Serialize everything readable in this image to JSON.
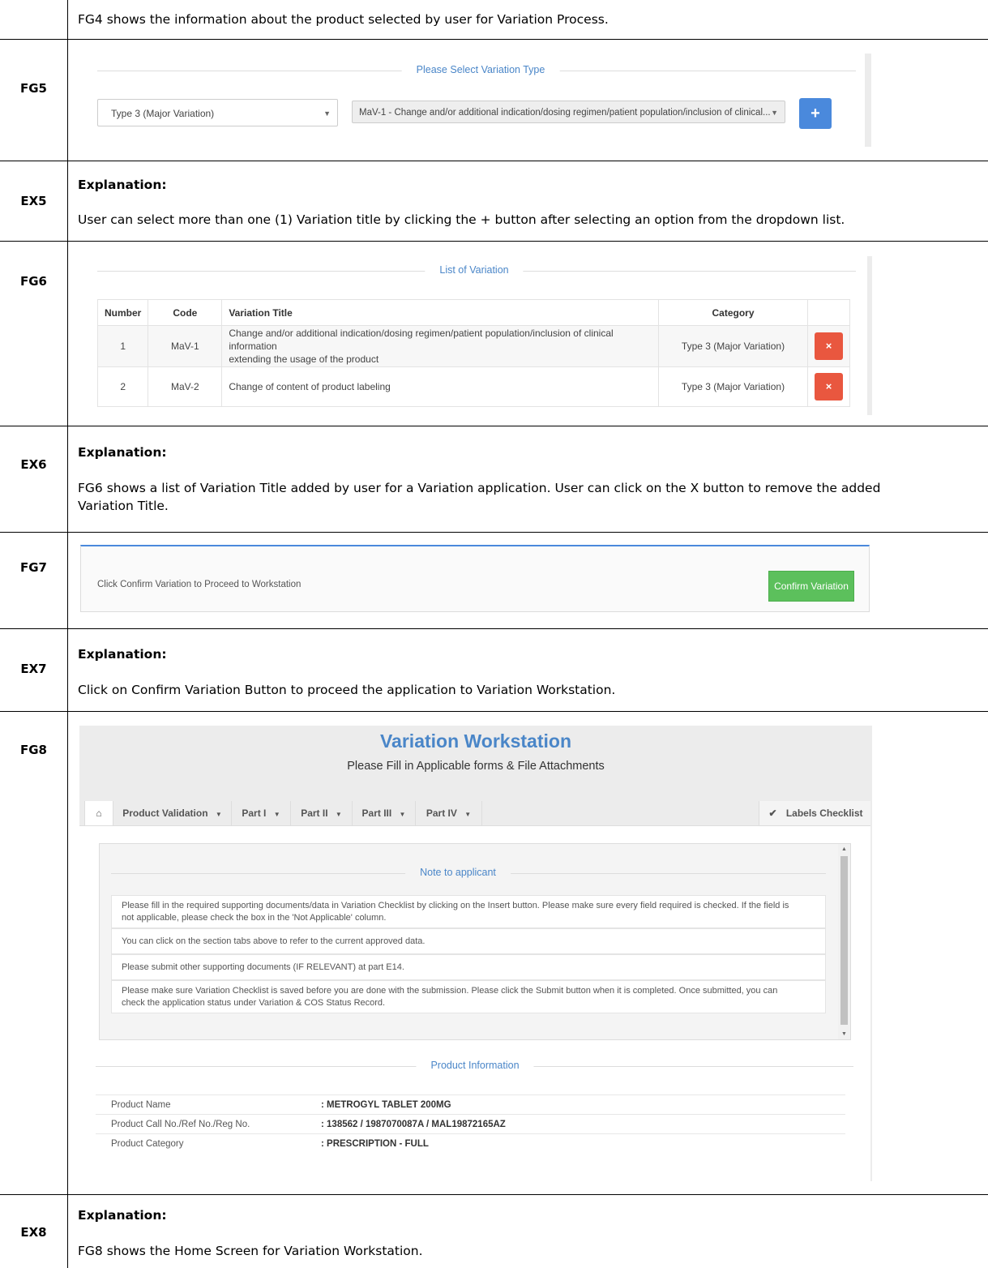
{
  "rows": {
    "fg4": {
      "text": "FG4 shows the information about the product selected by user for Variation Process."
    },
    "fg5": {
      "label": "FG5",
      "legend": "Please Select Variation Type",
      "type_select": "Type 3 (Major Variation)",
      "title_select": "MaV-1 - Change and/or additional indication/dosing regimen/patient population/inclusion of clinical...",
      "add_button": "+"
    },
    "ex5": {
      "label": "EX5",
      "heading": "Explanation:",
      "text": "User can select more than one (1) Variation title by clicking the + button after selecting an option from the dropdown list."
    },
    "fg6": {
      "label": "FG6",
      "legend": "List of Variation",
      "columns": [
        "Number",
        "Code",
        "Variation Title",
        "Category"
      ],
      "rows": [
        {
          "number": "1",
          "code": "MaV-1",
          "title_l1": "Change and/or additional indication/dosing regimen/patient population/inclusion of clinical information",
          "title_l2": "extending the usage of the product",
          "category": "Type 3 (Major Variation)"
        },
        {
          "number": "2",
          "code": "MaV-2",
          "title_l1": "Change of content of product labeling",
          "title_l2": "",
          "category": "Type 3 (Major Variation)"
        }
      ],
      "remove_button": "×"
    },
    "ex6": {
      "label": "EX6",
      "heading": "Explanation:",
      "text_l1": "FG6 shows a list of Variation Title added by user for a Variation application. User can click on the X button to remove the added",
      "text_l2": "Variation Title."
    },
    "fg7": {
      "label": "FG7",
      "text": "Click Confirm Variation to Proceed to Workstation",
      "button": "Confirm Variation"
    },
    "ex7": {
      "label": "EX7",
      "heading": "Explanation:",
      "text": "Click on Confirm Variation Button to proceed the application to Variation Workstation."
    },
    "fg8": {
      "label": "FG8",
      "title": "Variation Workstation",
      "subtitle": "Please Fill in Applicable forms & File Attachments",
      "tabs": [
        "Product Validation",
        "Part I",
        "Part II",
        "Part III",
        "Part IV"
      ],
      "labels_checklist": "Labels Checklist",
      "note_legend": "Note to applicant",
      "notes": [
        {
          "l1": "Please fill in the required supporting documents/data in Variation Checklist by clicking on the Insert button. Please make sure every field required is checked. If the field is",
          "l2": "not applicable, please check the box in the 'Not Applicable' column."
        },
        {
          "l1": "You can click on the section tabs above to refer to the current approved data.",
          "l2": ""
        },
        {
          "l1": "Please submit other supporting documents (IF RELEVANT) at part E14.",
          "l2": ""
        },
        {
          "l1": "Please make sure Variation Checklist is saved before you are done with the submission. Please click the Submit button when it is completed. Once submitted, you can",
          "l2": "check the application status under Variation & COS Status Record."
        }
      ],
      "product_legend": "Product Information",
      "product_info": [
        {
          "key": "Product Name",
          "value": ": METROGYL TABLET 200MG"
        },
        {
          "key": "Product Call No./Ref No./Reg No.",
          "value": ": 138562 / 1987070087A / MAL19872165AZ"
        },
        {
          "key": "Product Category",
          "value": ": PRESCRIPTION - FULL"
        }
      ]
    },
    "ex8": {
      "label": "EX8",
      "heading": "Explanation:",
      "text": "FG8 shows the Home Screen for Variation Workstation."
    }
  },
  "colors": {
    "accent_blue": "#4a89dc",
    "remove_red": "#e9573f",
    "confirm_green": "#5cc05c",
    "legend_blue": "#4a86c8"
  }
}
